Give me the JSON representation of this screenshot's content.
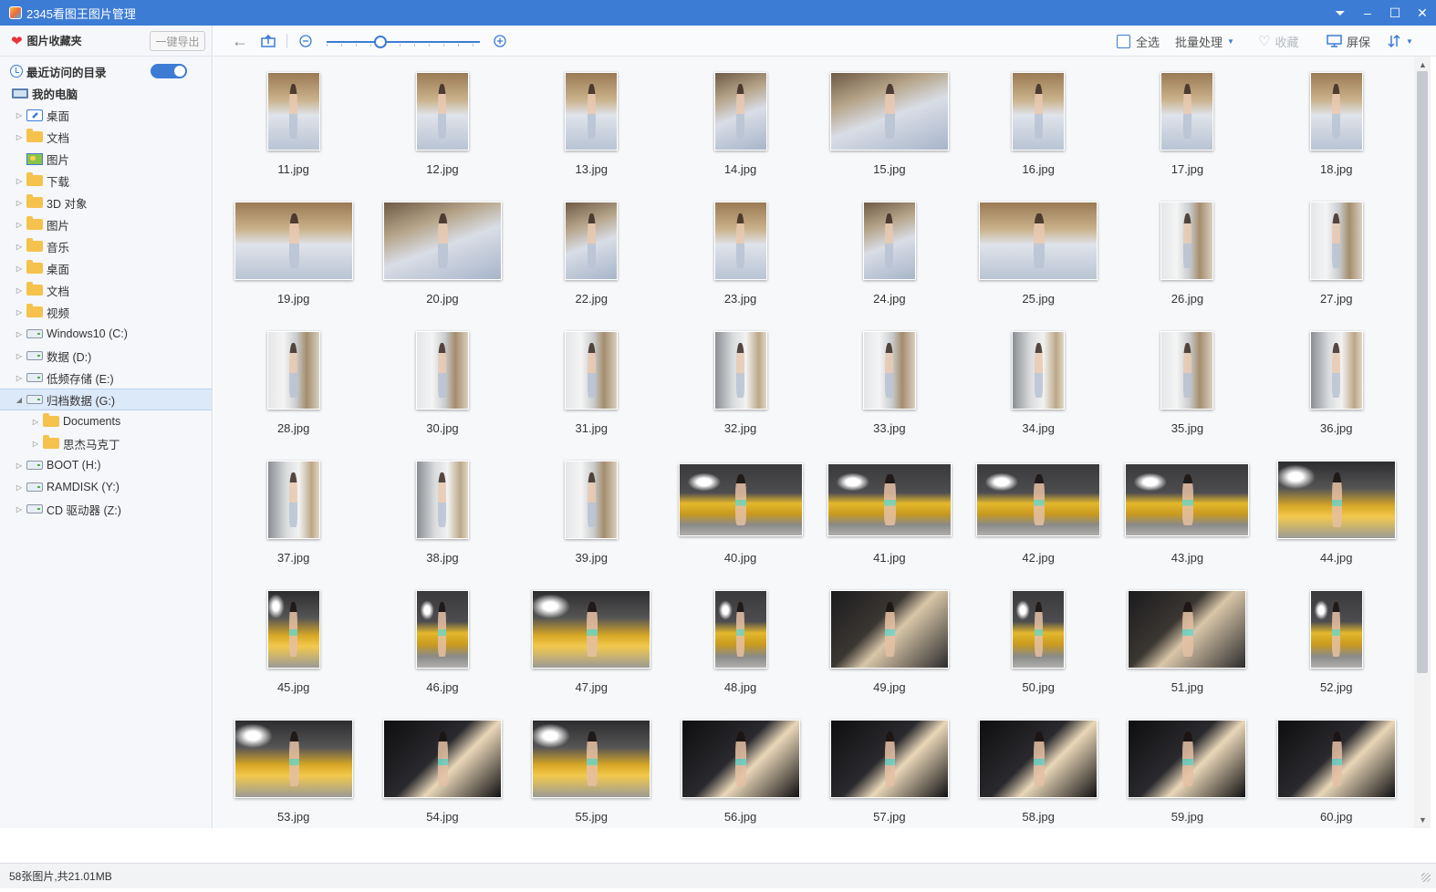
{
  "window": {
    "title": "2345看图王图片管理",
    "buttons": [
      "dropdown-icon",
      "minimize-icon",
      "maximize-icon",
      "close-icon"
    ]
  },
  "sidebar": {
    "favorites_title": "图片收藏夹",
    "export_label": "一键导出",
    "recent_label": "最近访问的目录",
    "recent_toggle_on": true,
    "computer_label": "我的电脑",
    "tree": [
      {
        "label": "桌面",
        "icon": "desktop-icon",
        "level": 1,
        "expandable": true
      },
      {
        "label": "文档",
        "icon": "folder-icon",
        "level": 1,
        "expandable": true
      },
      {
        "label": "图片",
        "icon": "picture-icon",
        "level": 1,
        "expandable": false
      },
      {
        "label": "下载",
        "icon": "folder-icon",
        "level": 1,
        "expandable": true
      },
      {
        "label": "3D 对象",
        "icon": "folder-icon",
        "level": 1,
        "expandable": true
      },
      {
        "label": "图片",
        "icon": "folder-icon",
        "level": 1,
        "expandable": true
      },
      {
        "label": "音乐",
        "icon": "folder-icon",
        "level": 1,
        "expandable": true
      },
      {
        "label": "桌面",
        "icon": "folder-icon",
        "level": 1,
        "expandable": true
      },
      {
        "label": "文档",
        "icon": "folder-icon",
        "level": 1,
        "expandable": true
      },
      {
        "label": "视频",
        "icon": "folder-icon",
        "level": 1,
        "expandable": true
      },
      {
        "label": "Windows10 (C:)",
        "icon": "drive-icon",
        "level": 1,
        "expandable": true
      },
      {
        "label": "数据 (D:)",
        "icon": "drive-icon",
        "level": 1,
        "expandable": true
      },
      {
        "label": "低频存储 (E:)",
        "icon": "drive-icon",
        "level": 1,
        "expandable": true
      },
      {
        "label": "归档数据 (G:)",
        "icon": "drive-icon",
        "level": 1,
        "expandable": true,
        "expanded": true,
        "selected": true
      },
      {
        "label": "Documents",
        "icon": "folder-icon",
        "level": 2,
        "expandable": true
      },
      {
        "label": "思杰马克丁",
        "icon": "folder-icon",
        "level": 2,
        "expandable": true
      },
      {
        "label": "BOOT (H:)",
        "icon": "drive-icon",
        "level": 1,
        "expandable": true
      },
      {
        "label": "RAMDISK (Y:)",
        "icon": "drive-icon",
        "level": 1,
        "expandable": true
      },
      {
        "label": "CD 驱动器 (Z:)",
        "icon": "drive-icon",
        "level": 1,
        "expandable": true
      }
    ]
  },
  "toolbar": {
    "back_icon": "back-arrow-icon",
    "upload_icon": "upload-icon",
    "zoom_out_icon": "zoom-out-icon",
    "zoom_in_icon": "zoom-in-icon",
    "zoom_level_fraction": 0.35,
    "select_all_label": "全选",
    "batch_label": "批量处理",
    "favorite_label": "收藏",
    "screensaver_label": "屏保",
    "sort_icon": "sort-icon"
  },
  "thumbnails": [
    {
      "name": "11.jpg",
      "shape": "p",
      "style": "bed"
    },
    {
      "name": "12.jpg",
      "shape": "p",
      "style": "bed"
    },
    {
      "name": "13.jpg",
      "shape": "p",
      "style": "bed"
    },
    {
      "name": "14.jpg",
      "shape": "p",
      "style": "bed2"
    },
    {
      "name": "15.jpg",
      "shape": "l",
      "style": "bed2"
    },
    {
      "name": "16.jpg",
      "shape": "p",
      "style": "bed"
    },
    {
      "name": "17.jpg",
      "shape": "p",
      "style": "bed"
    },
    {
      "name": "18.jpg",
      "shape": "p",
      "style": "bed"
    },
    {
      "name": "19.jpg",
      "shape": "l",
      "style": "bed"
    },
    {
      "name": "20.jpg",
      "shape": "l",
      "style": "bed2"
    },
    {
      "name": "22.jpg",
      "shape": "p",
      "style": "bed2"
    },
    {
      "name": "23.jpg",
      "shape": "p",
      "style": "bed"
    },
    {
      "name": "24.jpg",
      "shape": "p",
      "style": "bed2"
    },
    {
      "name": "25.jpg",
      "shape": "l",
      "style": "bed"
    },
    {
      "name": "26.jpg",
      "shape": "p",
      "style": "win"
    },
    {
      "name": "27.jpg",
      "shape": "p",
      "style": "win"
    },
    {
      "name": "28.jpg",
      "shape": "p",
      "style": "win"
    },
    {
      "name": "30.jpg",
      "shape": "p",
      "style": "win"
    },
    {
      "name": "31.jpg",
      "shape": "p",
      "style": "win"
    },
    {
      "name": "32.jpg",
      "shape": "p",
      "style": "win2"
    },
    {
      "name": "33.jpg",
      "shape": "p",
      "style": "win"
    },
    {
      "name": "34.jpg",
      "shape": "p",
      "style": "win2"
    },
    {
      "name": "35.jpg",
      "shape": "p",
      "style": "win"
    },
    {
      "name": "36.jpg",
      "shape": "p",
      "style": "win2"
    },
    {
      "name": "37.jpg",
      "shape": "p",
      "style": "win2"
    },
    {
      "name": "38.jpg",
      "shape": "p",
      "style": "win2"
    },
    {
      "name": "39.jpg",
      "shape": "p",
      "style": "win"
    },
    {
      "name": "40.jpg",
      "shape": "lc",
      "style": "car"
    },
    {
      "name": "41.jpg",
      "shape": "lc",
      "style": "car"
    },
    {
      "name": "42.jpg",
      "shape": "lc",
      "style": "car"
    },
    {
      "name": "43.jpg",
      "shape": "lc",
      "style": "car"
    },
    {
      "name": "44.jpg",
      "shape": "l",
      "style": "car2"
    },
    {
      "name": "45.jpg",
      "shape": "p",
      "style": "car2"
    },
    {
      "name": "46.jpg",
      "shape": "p",
      "style": "car"
    },
    {
      "name": "47.jpg",
      "shape": "l",
      "style": "car2"
    },
    {
      "name": "48.jpg",
      "shape": "p",
      "style": "car"
    },
    {
      "name": "49.jpg",
      "shape": "l",
      "style": "dark"
    },
    {
      "name": "50.jpg",
      "shape": "p",
      "style": "car"
    },
    {
      "name": "51.jpg",
      "shape": "l",
      "style": "dark"
    },
    {
      "name": "52.jpg",
      "shape": "p",
      "style": "car"
    },
    {
      "name": "53.jpg",
      "shape": "l",
      "style": "car2"
    },
    {
      "name": "54.jpg",
      "shape": "l",
      "style": "interior"
    },
    {
      "name": "55.jpg",
      "shape": "l",
      "style": "car2"
    },
    {
      "name": "56.jpg",
      "shape": "l",
      "style": "interior"
    },
    {
      "name": "57.jpg",
      "shape": "l",
      "style": "interior"
    },
    {
      "name": "58.jpg",
      "shape": "l",
      "style": "interior"
    },
    {
      "name": "59.jpg",
      "shape": "l",
      "style": "interior"
    },
    {
      "name": "60.jpg",
      "shape": "l",
      "style": "interior"
    }
  ],
  "status": {
    "text": "58张图片,共21.01MB"
  },
  "colors": {
    "accent": "#3c7cd5",
    "favorite_heart": "#e8353b",
    "folder": "#f5c24c"
  }
}
